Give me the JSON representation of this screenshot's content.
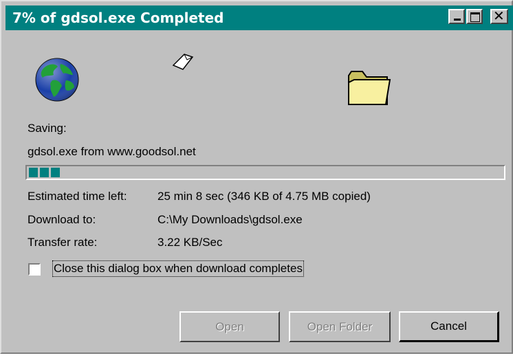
{
  "window": {
    "title": "7% of gdsol.exe Completed",
    "minimize_icon": "minimize-icon",
    "maximize_icon": "maximize-icon",
    "close_icon": "close-icon"
  },
  "animation": {
    "globe_icon": "globe-icon",
    "paper_icon": "flying-paper-icon",
    "folder_icon": "folder-icon"
  },
  "status": {
    "saving_label": "Saving:",
    "file_source": "gdsol.exe from www.goodsol.net"
  },
  "progress": {
    "percent": 7,
    "colors": {
      "fill": "#008080",
      "track": "#c0c0c0"
    }
  },
  "details": {
    "time_left_label": "Estimated time left:",
    "time_left_value": "25 min 8 sec (346 KB of 4.75 MB copied)",
    "download_to_label": "Download to:",
    "download_to_value": "C:\\My Downloads\\gdsol.exe",
    "transfer_rate_label": "Transfer rate:",
    "transfer_rate_value": "3.22 KB/Sec"
  },
  "options": {
    "close_when_done_label": "Close this dialog box when download completes",
    "close_when_done_checked": false
  },
  "buttons": {
    "open": "Open",
    "open_folder": "Open Folder",
    "cancel": "Cancel"
  },
  "colors": {
    "titlebar": "#008080",
    "face": "#c0c0c0"
  }
}
